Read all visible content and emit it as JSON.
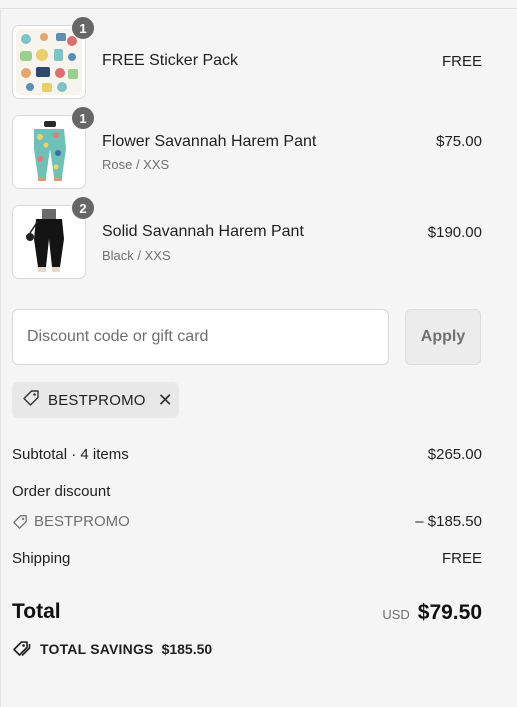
{
  "cart": {
    "items": [
      {
        "name": "FREE Sticker Pack",
        "variant": "",
        "price": "FREE",
        "quantity": "1",
        "image_icon": "sticker-pack-thumbnail"
      },
      {
        "name": "Flower Savannah Harem Pant",
        "variant": "Rose / XXS",
        "price": "$75.00",
        "quantity": "1",
        "image_icon": "flower-pant-thumbnail"
      },
      {
        "name": "Solid Savannah Harem Pant",
        "variant": "Black / XXS",
        "price": "$190.00",
        "quantity": "2",
        "image_icon": "solid-pant-thumbnail"
      }
    ]
  },
  "discount": {
    "placeholder": "Discount code or gift card",
    "value": "",
    "apply_label": "Apply",
    "applied_code": "BESTPROMO"
  },
  "summary": {
    "subtotal_label": "Subtotal · 4 items",
    "subtotal_value": "$265.00",
    "order_discount_label": "Order discount",
    "discount_code": "BESTPROMO",
    "discount_value": "– $185.50",
    "shipping_label": "Shipping",
    "shipping_value": "FREE",
    "total_label": "Total",
    "currency": "USD",
    "total_value": "$79.50",
    "savings_label": "TOTAL SAVINGS",
    "savings_value": "$185.50"
  },
  "colors": {
    "background": "#f5f5f5",
    "badge": "#666666",
    "muted_text": "#707070"
  }
}
